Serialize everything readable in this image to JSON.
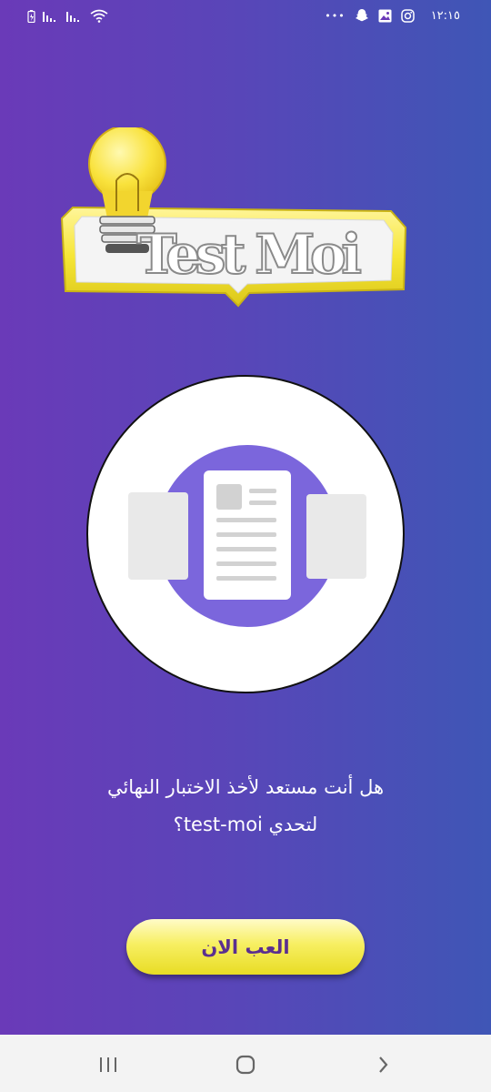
{
  "status_bar": {
    "time": "١٢:١٥",
    "more": "•••",
    "icons": [
      "battery-icon",
      "signal-icon",
      "signal-icon",
      "wifi-icon",
      "snapchat-icon",
      "gallery-icon",
      "instagram-icon"
    ]
  },
  "logo": {
    "text": "Test Moi",
    "colors": {
      "frame": "#f6e636",
      "bulb": "#f9e23c",
      "text": "#ffffff"
    }
  },
  "illustration": {
    "icon": "document-pages-icon",
    "colors": {
      "ring": "#7b66dc",
      "page": "#ffffff",
      "side_page": "#e9e9e9",
      "line": "#d2d2d2"
    }
  },
  "prompt": {
    "line1": "هل أنت مستعد لأخذ الاختبار النهائي",
    "line2": "لتحدي test-moi؟"
  },
  "play_button": {
    "label": "العب الان"
  },
  "nav_bar": {
    "icons": [
      "recent-apps-icon",
      "home-icon",
      "back-icon"
    ]
  },
  "colors": {
    "background_start": "#6a3ab8",
    "background_end": "#3f56b6",
    "button": "#f3ea4a",
    "button_text": "#5b2f8f"
  }
}
